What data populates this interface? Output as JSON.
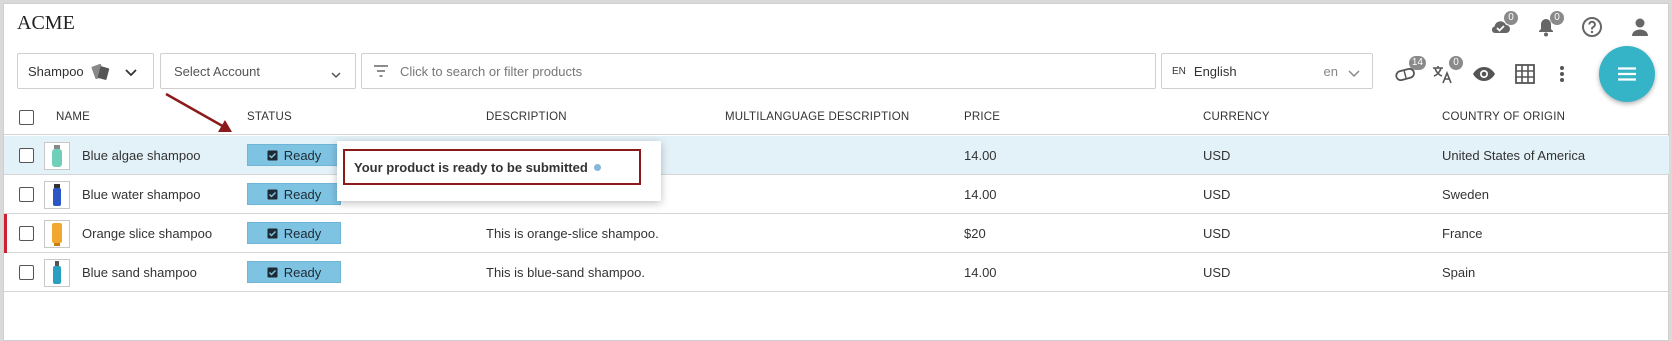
{
  "app": {
    "title": "ACME"
  },
  "header": {
    "icons": [
      {
        "name": "cloud-check-icon",
        "badge": "0"
      },
      {
        "name": "bell-icon",
        "badge": "0"
      },
      {
        "name": "help-icon"
      },
      {
        "name": "user-icon"
      }
    ]
  },
  "toolbar": {
    "category": {
      "value": "Shampoo"
    },
    "account": {
      "placeholder": "Select Account"
    },
    "search": {
      "placeholder": "Click to search or filter products"
    },
    "language": {
      "code": "EN",
      "value": "English",
      "short": "en"
    },
    "tools": [
      {
        "name": "pill-icon",
        "badge": "14"
      },
      {
        "name": "translate-icon",
        "badge": "0"
      },
      {
        "name": "eye-icon"
      },
      {
        "name": "grid-icon"
      },
      {
        "name": "more-vertical-icon"
      }
    ],
    "fab_icon": "menu-icon"
  },
  "table": {
    "columns": [
      "NAME",
      "STATUS",
      "DESCRIPTION",
      "MULTILANGUAGE DESCRIPTION",
      "PRICE",
      "CURRENCY",
      "COUNTRY OF ORIGIN"
    ],
    "rows": [
      {
        "name": "Blue algae shampoo",
        "status": "Ready",
        "description": "",
        "multilanguage": "",
        "price": "14.00",
        "currency": "USD",
        "country": "United States of America",
        "selected": true,
        "thumb_color": "#6fcfb8"
      },
      {
        "name": "Blue water shampoo",
        "status": "Ready",
        "description": "",
        "multilanguage": "",
        "price": "14.00",
        "currency": "USD",
        "country": "Sweden",
        "thumb_color": "#2a56c6"
      },
      {
        "name": "Orange slice shampoo",
        "status": "Ready",
        "description": "This is orange-slice shampoo.",
        "multilanguage": "",
        "price": "$20",
        "currency": "USD",
        "country": "France",
        "marked": true,
        "thumb_color": "#f2a830"
      },
      {
        "name": "Blue sand shampoo",
        "status": "Ready",
        "description": "This is blue-sand shampoo.",
        "multilanguage": "",
        "price": "14.00",
        "currency": "USD",
        "country": "Spain",
        "thumb_color": "#2a9fc0"
      }
    ]
  },
  "popover": {
    "text": "Your product is ready to be submitted"
  },
  "colors": {
    "accent": "#35b4c8",
    "status_bg": "#7fc3e3",
    "selected_row": "#e3f1f8",
    "annotation": "#8b1a1a",
    "row_marker": "#cc2233"
  }
}
